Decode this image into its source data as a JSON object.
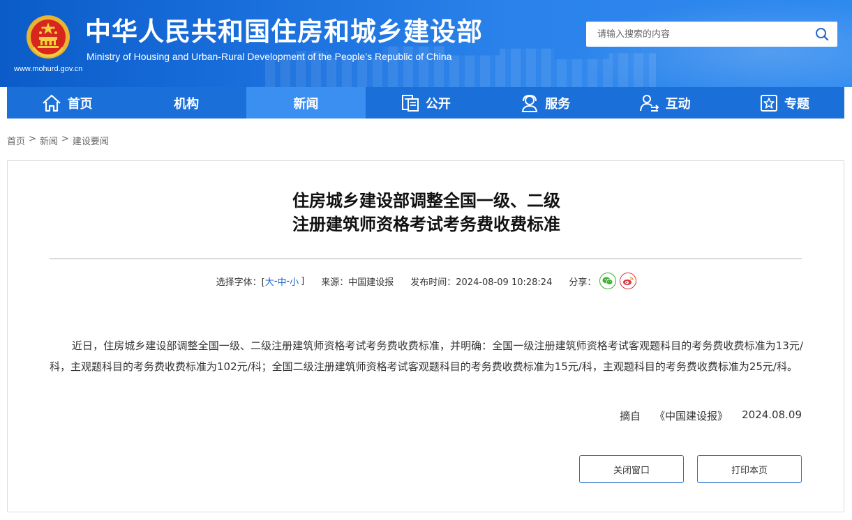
{
  "header": {
    "site_title": "中华人民共和国住房和城乡建设部",
    "site_subtitle": "Ministry of Housing and Urban-Rural Development of the People’s Republic of China",
    "site_url": "www.mohurd.gov.cn",
    "search_placeholder": "请输入搜索的内容"
  },
  "nav": {
    "items": [
      {
        "label": "首页",
        "icon": "home-icon"
      },
      {
        "label": "机构",
        "icon": ""
      },
      {
        "label": "新闻",
        "icon": "",
        "active": true
      },
      {
        "label": "公开",
        "icon": "document-icon"
      },
      {
        "label": "服务",
        "icon": "service-icon"
      },
      {
        "label": "互动",
        "icon": "interaction-icon"
      },
      {
        "label": "专题",
        "icon": "star-icon"
      }
    ]
  },
  "breadcrumb": {
    "items": [
      "首页",
      "新闻",
      "建设要闻"
    ],
    "separator": ">"
  },
  "article": {
    "title_line1": "住房城乡建设部调整全国一级、二级",
    "title_line2": "注册建筑师资格考试考务费收费标准",
    "font_size_label": "选择字体：[",
    "font_large": "大",
    "font_medium": "中",
    "font_small": "小",
    "font_sep": "-",
    "font_close": "]",
    "source_label": "来源：中国建设报",
    "publish_time": "发布时间：2024-08-09 10:28:24",
    "share_label": "分享：",
    "body": "近日，住房城乡建设部调整全国一级、二级注册建筑师资格考试考务费收费标准，并明确：全国一级注册建筑师资格考试客观题科目的考务费收费标准为13元/科，主观题科目的考务费收费标准为102元/科；全国二级注册建筑师资格考试客观题科目的考务费收费标准为15元/科，主观题科目的考务费收费标准为25元/科。",
    "excerpt_label": "摘自",
    "excerpt_source": "《中国建设报》",
    "excerpt_date": "2024.08.09"
  },
  "buttons": {
    "close_label": "关闭窗口",
    "print_label": "打印本页"
  },
  "colors": {
    "header_blue": "#1a6fdc",
    "nav_blue": "#1b6fd8",
    "nav_active": "#3b8ff0",
    "link_blue": "#1b63c6",
    "wechat_green": "#3cb034",
    "weibo_red": "#e0333f"
  }
}
